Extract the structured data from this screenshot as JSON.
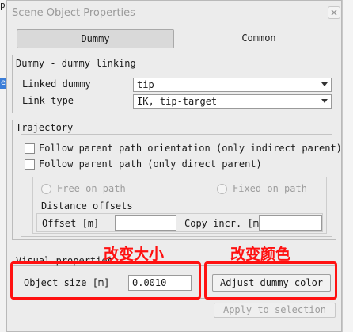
{
  "window": {
    "title": "Scene Object Properties"
  },
  "tabs": [
    {
      "label": "Dummy",
      "selected": true
    },
    {
      "label": "Common",
      "selected": false
    }
  ],
  "linking": {
    "title": "Dummy - dummy linking",
    "linked_dummy_label": "Linked dummy",
    "linked_dummy_value": "tip",
    "link_type_label": "Link type",
    "link_type_value": "IK, tip-target"
  },
  "trajectory": {
    "title": "Trajectory",
    "follow_orientation_label": "Follow parent path orientation (only indirect parent)",
    "follow_orientation_checked": false,
    "follow_path_label": "Follow parent path (only direct parent)",
    "follow_path_checked": false,
    "free_on_path_label": "Free on path",
    "fixed_on_path_label": "Fixed on path",
    "distance_offsets_label": "Distance offsets",
    "offset_label": "Offset [m]",
    "offset_value": "",
    "copy_incr_label": "Copy incr. [m]",
    "copy_incr_value": ""
  },
  "visual": {
    "title": "Visual properties",
    "object_size_label": "Object size [m]",
    "object_size_value": "0.0010",
    "adjust_color_label": "Adjust dummy color"
  },
  "apply_label": "Apply to selection",
  "annotations": {
    "size_note": "改变大小",
    "color_note": "改变颜色",
    "color": "#ff1111"
  },
  "background": {
    "left_char": "p",
    "left_selected_char": "e"
  }
}
